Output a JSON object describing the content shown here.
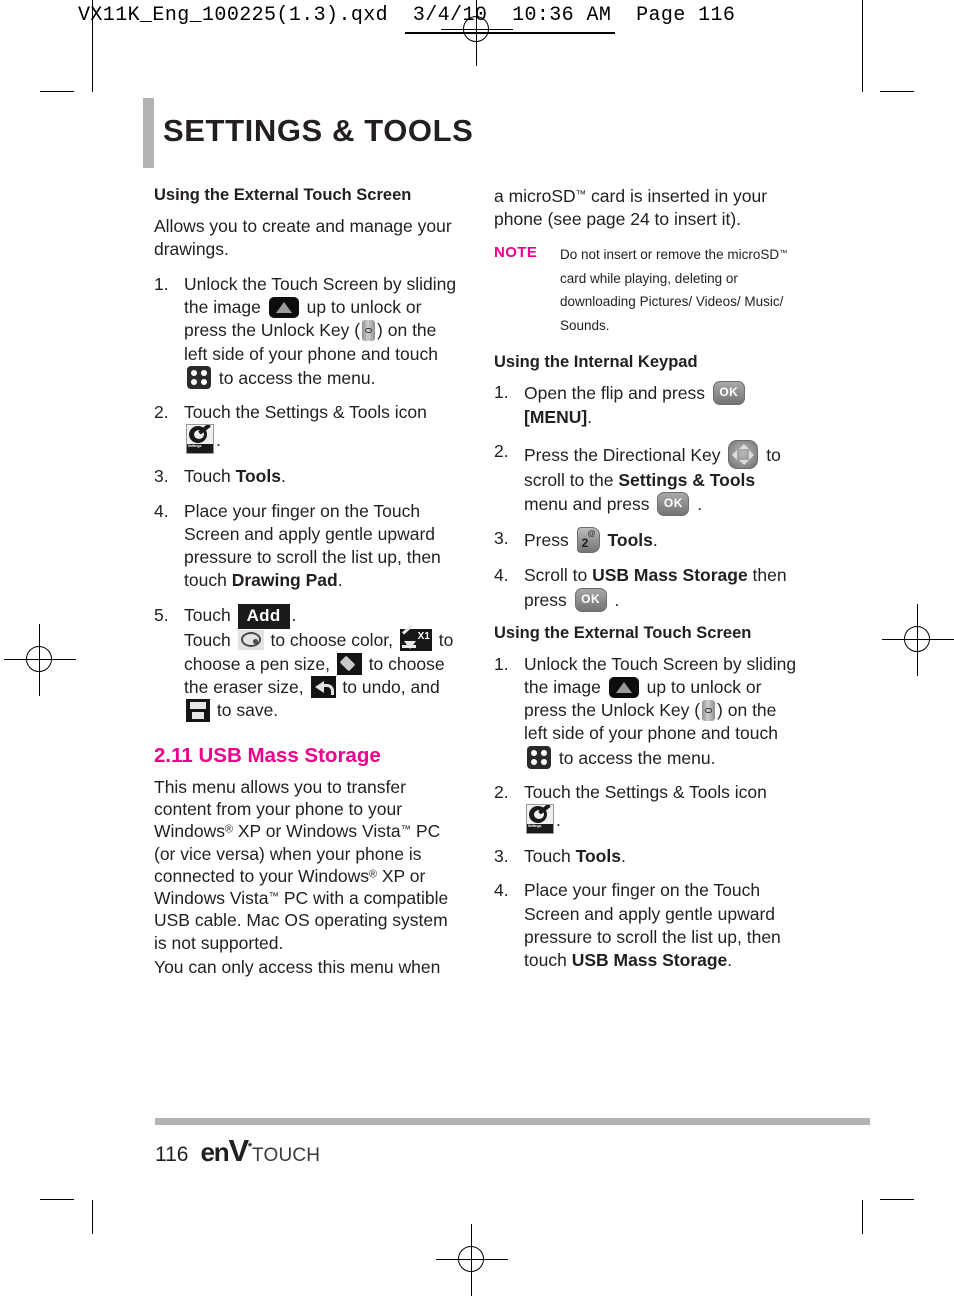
{
  "slug": {
    "text": "VX11K_Eng_100225(1.3).qxd  3/4/10  10:36 AM  Page 116"
  },
  "page": {
    "title": "SETTINGS & TOOLS",
    "number": "116",
    "brand_env": "en",
    "brand_v": "V",
    "brand_star": "*",
    "brand_touch": "TOUCH",
    "accent_color": "#ec008c",
    "rule_color": "#b3b3b3"
  },
  "left_column": {
    "heading": "Using the External Touch Screen",
    "intro": "Allows you to create and manage your drawings.",
    "steps": [
      {
        "num": "1.",
        "seg1": "Unlock the Touch Screen by sliding the image",
        "seg2": "up to unlock or press the Unlock Key (",
        "seg3": ") on the left side of your phone and touch",
        "seg4": "to access the menu."
      },
      {
        "num": "2.",
        "seg1": "Touch the Settings & Tools icon",
        "seg2": "."
      },
      {
        "num": "3.",
        "seg1": "Touch ",
        "bold1": "Tools",
        "seg2": "."
      },
      {
        "num": "4.",
        "seg1": "Place your finger on the Touch Screen and apply gentle upward pressure to scroll the list up, then touch ",
        "bold1": "Drawing Pad",
        "seg2": "."
      },
      {
        "num": "5.",
        "seg1": "Touch",
        "add_label": "Add",
        "seg2": ".",
        "seg3": "Touch",
        "seg4": "to choose color,",
        "seg5": "to choose a pen size,",
        "seg6": "to choose the eraser size,",
        "seg7": "to undo, and",
        "seg8": "to save.",
        "pen_multiplier": "X1"
      }
    ],
    "section": {
      "title": "2.11 USB Mass Storage",
      "para1_a": "This menu allows you to transfer content from your phone to your Windows",
      "para1_reg1": "®",
      "para1_b": " XP or Windows Vista",
      "para1_tm1": "™",
      "para1_c": " PC (or vice versa) when your phone is connected to your Windows",
      "para1_reg2": "®",
      "para1_d": " XP or Windows Vista",
      "para1_tm2": "™",
      "para1_e": " PC with a compatible USB cable. Mac OS operating system is not supported.",
      "para2": "You can only access this menu when"
    }
  },
  "right_column": {
    "continued_a": "a microSD",
    "continued_tm": "™",
    "continued_b": " card is inserted in your phone (see page 24 to insert it).",
    "note": {
      "label": "NOTE",
      "text_a": "Do not insert or remove the microSD",
      "text_tm": "™",
      "text_b": " card while playing, deleting or downloading Pictures/ Videos/ Music/ Sounds."
    },
    "keypad_heading": "Using the Internal Keypad",
    "keypad_steps": [
      {
        "num": "1.",
        "seg1": "Open the flip and press",
        "seg2": "",
        "bold1": "[MENU]",
        "seg3": "."
      },
      {
        "num": "2.",
        "seg1": "Press the Directional Key",
        "seg2": "to scroll to the ",
        "bold1": "Settings & Tools",
        "seg3": " menu and press",
        "seg4": "."
      },
      {
        "num": "3.",
        "seg1": "Press",
        "bold1": "Tools",
        "seg2": "."
      },
      {
        "num": "4.",
        "seg1": "Scroll to ",
        "bold1": "USB Mass Storage",
        "seg2": " then press",
        "seg3": "."
      }
    ],
    "touch_heading": "Using the External Touch Screen",
    "touch_steps": [
      {
        "num": "1.",
        "seg1": "Unlock the Touch Screen by sliding the image",
        "seg2": "up to unlock or press the Unlock Key (",
        "seg3": ") on the left side of your phone and touch",
        "seg4": "to access the menu."
      },
      {
        "num": "2.",
        "seg1": "Touch the Settings & Tools icon",
        "seg2": "."
      },
      {
        "num": "3.",
        "seg1": "Touch ",
        "bold1": "Tools",
        "seg2": "."
      },
      {
        "num": "4.",
        "seg1": "Place your finger on the Touch Screen and apply gentle upward pressure to scroll the list up, then touch ",
        "bold1": "USB Mass Storage",
        "seg2": "."
      }
    ]
  },
  "icons": {
    "settings_tools_cap_line1": "Settings",
    "settings_tools_cap_line2": "& Tools",
    "ok_label": "OK",
    "key2_number": "2",
    "key2_symbol": "@"
  }
}
